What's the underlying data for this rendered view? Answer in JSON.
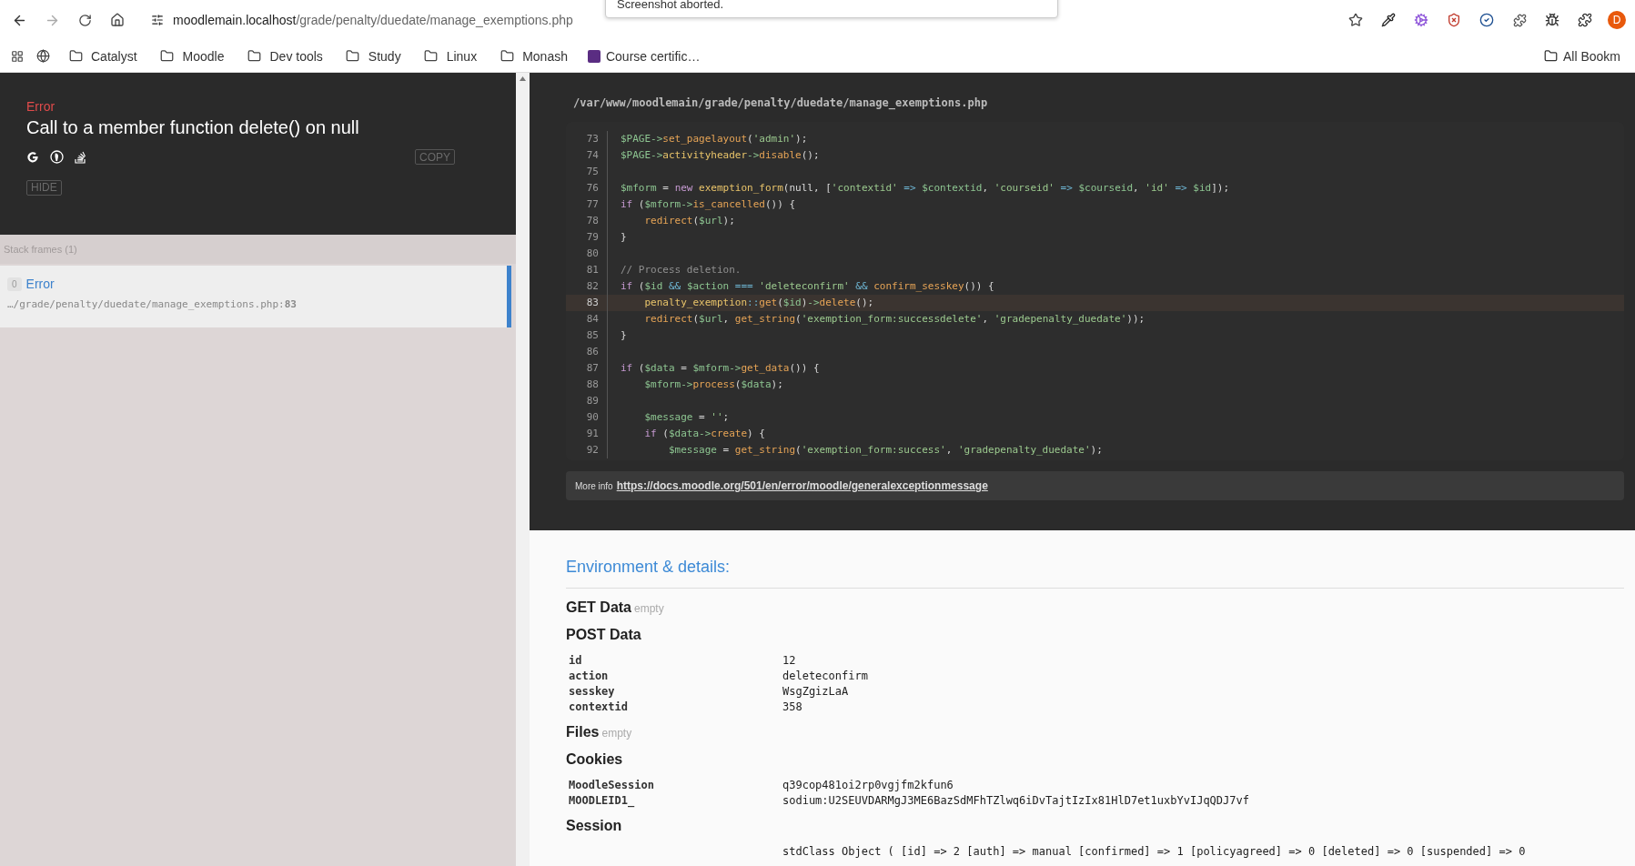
{
  "browser": {
    "url_host": "moodlemain.localhost",
    "url_path": "/grade/penalty/duedate/manage_exemptions.php",
    "notification": "Screenshot aborted.",
    "profile_initial": "D",
    "bookmarks": [
      {
        "kind": "folder",
        "label": "Catalyst"
      },
      {
        "kind": "folder",
        "label": "Moodle"
      },
      {
        "kind": "folder",
        "label": "Dev tools"
      },
      {
        "kind": "folder",
        "label": "Study"
      },
      {
        "kind": "folder",
        "label": "Linux"
      },
      {
        "kind": "folder",
        "label": "Monash"
      },
      {
        "kind": "site",
        "label": "Course certific…"
      }
    ],
    "all_bookmarks": "All Bookm"
  },
  "error": {
    "type": "Error",
    "message": "Call to a member function delete() on null",
    "copy_button": "COPY",
    "hide_button": "HIDE"
  },
  "stack": {
    "label": "Stack frames (1)",
    "frames": [
      {
        "index": "0",
        "name": "Error",
        "path": "…/grade/penalty/duedate/manage_exemptions.php:**83**",
        "selected": true
      }
    ]
  },
  "source": {
    "file": "/var/www/moodlemain/grade/penalty/duedate/manage_exemptions.php",
    "lines": [
      {
        "n": "73",
        "highlighted": false,
        "tokens": [
          {
            "kind": "variable",
            "t": "$PAGE->"
          },
          {
            "kind": "function",
            "t": "set_pagelayout"
          },
          {
            "kind": "plain",
            "t": "("
          },
          {
            "kind": "string",
            "t": "'admin'"
          },
          {
            "kind": "plain",
            "t": ");"
          }
        ]
      },
      {
        "n": "74",
        "highlighted": false,
        "tokens": [
          {
            "kind": "variable",
            "t": "$PAGE->"
          },
          {
            "kind": "class",
            "t": "activityheader"
          },
          {
            "kind": "variable",
            "t": "->"
          },
          {
            "kind": "function",
            "t": "disable"
          },
          {
            "kind": "plain",
            "t": "();"
          }
        ]
      },
      {
        "n": "75",
        "highlighted": false
      },
      {
        "n": "76",
        "highlighted": false,
        "tokens": [
          {
            "kind": "variable",
            "t": "$mform"
          },
          {
            "kind": "plain",
            "t": " = "
          },
          {
            "kind": "keyword",
            "t": "new"
          },
          {
            "kind": "class",
            "t": " exemption_form"
          },
          {
            "kind": "plain",
            "t": "(null, ["
          },
          {
            "kind": "string",
            "t": "'contextid'"
          },
          {
            "kind": "operator",
            "t": " => "
          },
          {
            "kind": "variable",
            "t": "$contextid"
          },
          {
            "kind": "plain",
            "t": ", "
          },
          {
            "kind": "string",
            "t": "'courseid'"
          },
          {
            "kind": "operator",
            "t": " => "
          },
          {
            "kind": "variable",
            "t": "$courseid"
          },
          {
            "kind": "plain",
            "t": ", "
          },
          {
            "kind": "string",
            "t": "'id'"
          },
          {
            "kind": "operator",
            "t": " => "
          },
          {
            "kind": "variable",
            "t": "$id"
          },
          {
            "kind": "plain",
            "t": "]);"
          }
        ]
      },
      {
        "n": "77",
        "highlighted": false,
        "tokens": [
          {
            "kind": "keyword",
            "t": "if"
          },
          {
            "kind": "plain",
            "t": " ("
          },
          {
            "kind": "variable",
            "t": "$mform->"
          },
          {
            "kind": "function",
            "t": "is_cancelled"
          },
          {
            "kind": "plain",
            "t": "()) {"
          }
        ]
      },
      {
        "n": "78",
        "highlighted": false,
        "tokens": [
          {
            "kind": "function",
            "t": "    redirect"
          },
          {
            "kind": "plain",
            "t": "("
          },
          {
            "kind": "variable",
            "t": "$url"
          },
          {
            "kind": "plain",
            "t": ");"
          }
        ]
      },
      {
        "n": "79",
        "highlighted": false,
        "tokens": [
          {
            "kind": "plain",
            "t": "}"
          }
        ]
      },
      {
        "n": "80",
        "highlighted": false
      },
      {
        "n": "81",
        "highlighted": false,
        "tokens": [
          {
            "kind": "comment",
            "t": "// Process deletion."
          }
        ]
      },
      {
        "n": "82",
        "highlighted": false,
        "tokens": [
          {
            "kind": "keyword",
            "t": "if"
          },
          {
            "kind": "plain",
            "t": " ("
          },
          {
            "kind": "variable",
            "t": "$id"
          },
          {
            "kind": "operator",
            "t": " && "
          },
          {
            "kind": "variable",
            "t": "$action"
          },
          {
            "kind": "operator",
            "t": " === "
          },
          {
            "kind": "string",
            "t": "'deleteconfirm'"
          },
          {
            "kind": "operator",
            "t": " && "
          },
          {
            "kind": "function",
            "t": "confirm_sesskey"
          },
          {
            "kind": "plain",
            "t": "()) {"
          }
        ]
      },
      {
        "n": "83",
        "highlighted": true,
        "tokens": [
          {
            "kind": "class",
            "t": "    penalty_exemption"
          },
          {
            "kind": "operator",
            "t": "::"
          },
          {
            "kind": "function",
            "t": "get"
          },
          {
            "kind": "plain",
            "t": "("
          },
          {
            "kind": "variable",
            "t": "$id"
          },
          {
            "kind": "plain",
            "t": ")"
          },
          {
            "kind": "variable",
            "t": "->"
          },
          {
            "kind": "function",
            "t": "delete"
          },
          {
            "kind": "plain",
            "t": "();"
          }
        ]
      },
      {
        "n": "84",
        "highlighted": false,
        "tokens": [
          {
            "kind": "function",
            "t": "    redirect"
          },
          {
            "kind": "plain",
            "t": "("
          },
          {
            "kind": "variable",
            "t": "$url"
          },
          {
            "kind": "plain",
            "t": ", "
          },
          {
            "kind": "function",
            "t": "get_string"
          },
          {
            "kind": "plain",
            "t": "("
          },
          {
            "kind": "string",
            "t": "'exemption_form:successdelete'"
          },
          {
            "kind": "plain",
            "t": ", "
          },
          {
            "kind": "string",
            "t": "'gradepenalty_duedate'"
          },
          {
            "kind": "plain",
            "t": "));"
          }
        ]
      },
      {
        "n": "85",
        "highlighted": false,
        "tokens": [
          {
            "kind": "plain",
            "t": "}"
          }
        ]
      },
      {
        "n": "86",
        "highlighted": false
      },
      {
        "n": "87",
        "highlighted": false,
        "tokens": [
          {
            "kind": "keyword",
            "t": "if"
          },
          {
            "kind": "plain",
            "t": " ("
          },
          {
            "kind": "variable",
            "t": "$data"
          },
          {
            "kind": "plain",
            "t": " = "
          },
          {
            "kind": "variable",
            "t": "$mform->"
          },
          {
            "kind": "function",
            "t": "get_data"
          },
          {
            "kind": "plain",
            "t": "()) {"
          }
        ]
      },
      {
        "n": "88",
        "highlighted": false,
        "tokens": [
          {
            "kind": "variable",
            "t": "    $mform->"
          },
          {
            "kind": "function",
            "t": "process"
          },
          {
            "kind": "plain",
            "t": "("
          },
          {
            "kind": "variable",
            "t": "$data"
          },
          {
            "kind": "plain",
            "t": ");"
          }
        ]
      },
      {
        "n": "89",
        "highlighted": false
      },
      {
        "n": "90",
        "highlighted": false,
        "tokens": [
          {
            "kind": "variable",
            "t": "    $message"
          },
          {
            "kind": "plain",
            "t": " = "
          },
          {
            "kind": "string",
            "t": "''"
          },
          {
            "kind": "plain",
            "t": ";"
          }
        ]
      },
      {
        "n": "91",
        "highlighted": false,
        "tokens": [
          {
            "kind": "keyword",
            "t": "    if"
          },
          {
            "kind": "plain",
            "t": " ("
          },
          {
            "kind": "variable",
            "t": "$data->"
          },
          {
            "kind": "function",
            "t": "create"
          },
          {
            "kind": "plain",
            "t": ") {"
          }
        ]
      },
      {
        "n": "92",
        "highlighted": false,
        "tokens": [
          {
            "kind": "variable",
            "t": "        $message"
          },
          {
            "kind": "plain",
            "t": " = "
          },
          {
            "kind": "function",
            "t": "get_string"
          },
          {
            "kind": "plain",
            "t": "("
          },
          {
            "kind": "string",
            "t": "'exemption_form:success'"
          },
          {
            "kind": "plain",
            "t": ", "
          },
          {
            "kind": "string",
            "t": "'gradepenalty_duedate'"
          },
          {
            "kind": "plain",
            "t": ");"
          }
        ]
      }
    ],
    "more_info_label": "More info",
    "more_info_link": "https://docs.moodle.org/501/en/error/moodle/generalexceptionmessage"
  },
  "details": {
    "heading": "Environment & details:",
    "sections": [
      {
        "title": "GET Data",
        "note": "empty"
      },
      {
        "title": "POST Data",
        "rows": [
          {
            "key": "id",
            "value": "12"
          },
          {
            "key": "action",
            "value": "deleteconfirm"
          },
          {
            "key": "sesskey",
            "value": "WsgZgizLaA"
          },
          {
            "key": "contextid",
            "value": "358"
          }
        ]
      },
      {
        "title": "Files",
        "note": "empty"
      },
      {
        "title": "Cookies",
        "rows": [
          {
            "key": "MoodleSession",
            "value": "q39cop481oi2rp0vgjfm2kfun6"
          },
          {
            "key": "MOODLEID1_",
            "value": "sodium:U2SEUVDARMgJ3ME6BazSdMFhTZlwq6iDvTajtIzIx81HlD7et1uxbYvIJqQDJ7vf"
          }
        ]
      },
      {
        "title": "Session",
        "rows": [
          {
            "value": "stdClass Object ( [id] => 2 [auth] => manual [confirmed] => 1 [policyagreed] => 0 [deleted] => 0 [suspended] => 0"
          }
        ]
      }
    ]
  }
}
